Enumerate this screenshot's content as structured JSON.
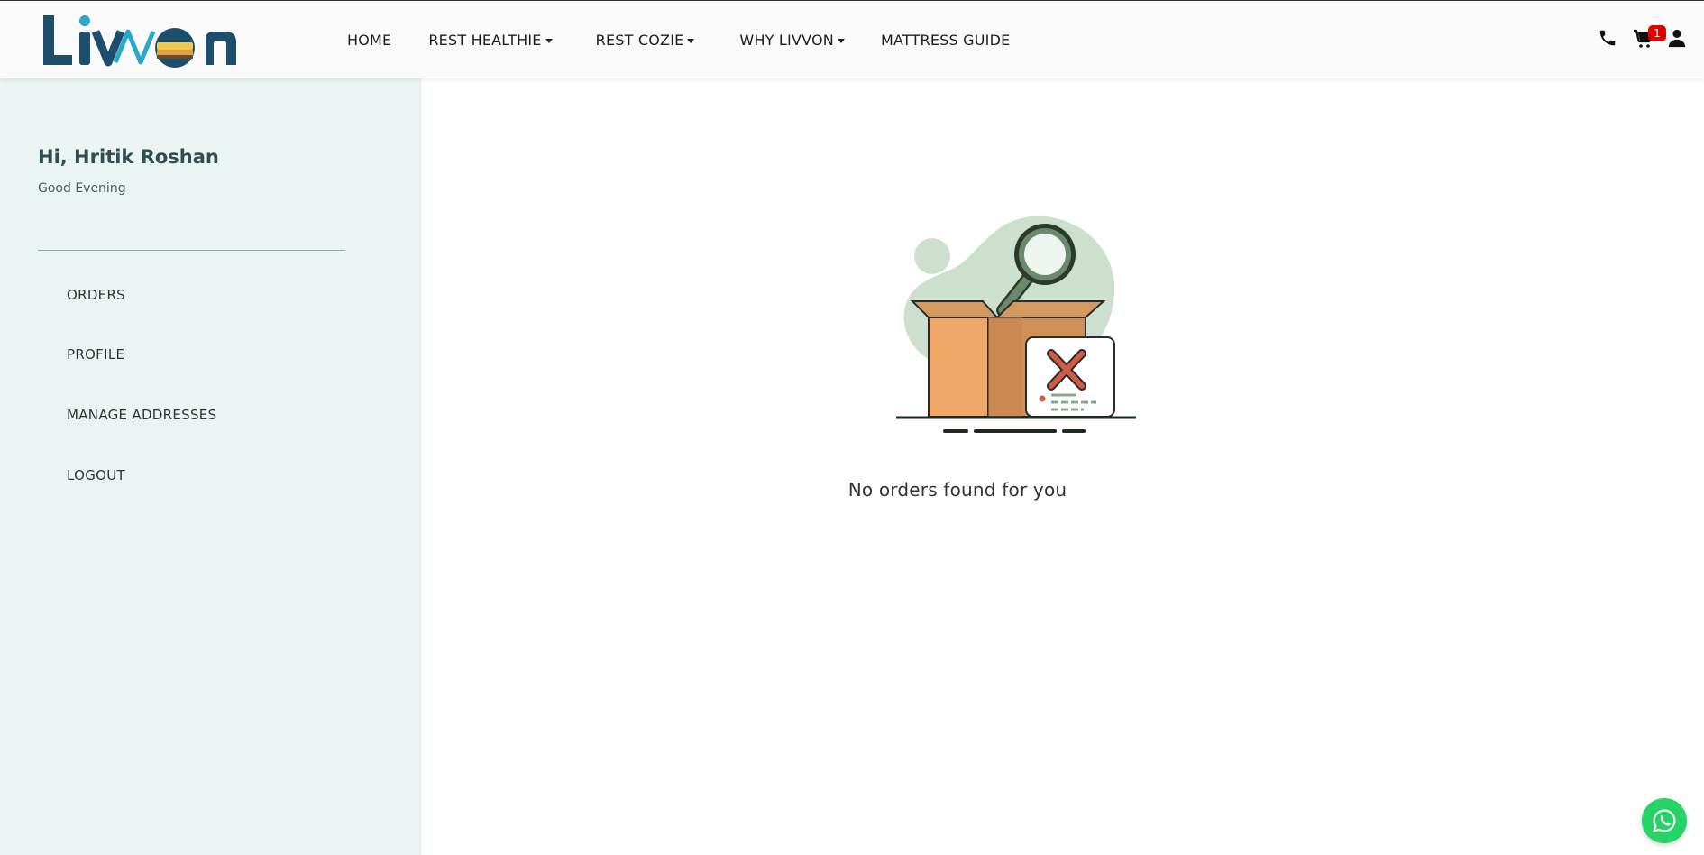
{
  "brand": {
    "name": "Livvon",
    "logo_text": "Livvon",
    "color_primary": "#1d4e6b",
    "color_accent": "#2aa7c9"
  },
  "nav": {
    "items": [
      {
        "label": "HOME",
        "has_dropdown": false
      },
      {
        "label": "REST HEALTHIE",
        "has_dropdown": true
      },
      {
        "label": "REST COZIE",
        "has_dropdown": true
      },
      {
        "label": "WHY LIVVON",
        "has_dropdown": true
      },
      {
        "label": "MATTRESS GUIDE",
        "has_dropdown": false
      }
    ]
  },
  "header_icons": {
    "phone": "phone-icon",
    "cart": "cart-icon",
    "cart_count": "1",
    "user": "user-icon",
    "badge_color": "#e00000"
  },
  "sidebar": {
    "greeting": "Hi, Hritik Roshan",
    "subgreeting": "Good Evening",
    "items": [
      {
        "label": "ORDERS"
      },
      {
        "label": "PROFILE"
      },
      {
        "label": "MANAGE ADDRESSES"
      },
      {
        "label": "LOGOUT"
      }
    ],
    "background": "#ebf4f3"
  },
  "main": {
    "empty_message": "No orders found for you",
    "illustration": "empty-box-search-icon"
  },
  "floating": {
    "whatsapp": "whatsapp-icon",
    "color": "#25d366"
  }
}
